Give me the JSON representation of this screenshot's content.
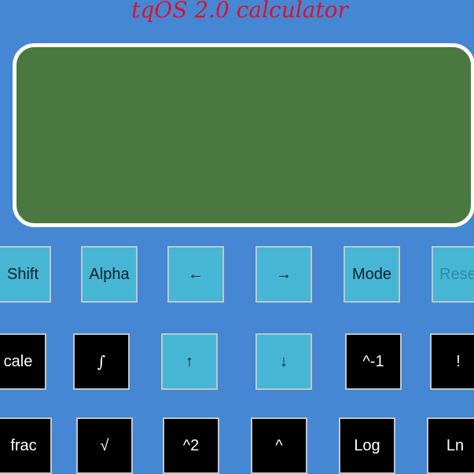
{
  "app": {
    "title": "tqOS 2.0 calculator"
  },
  "colors": {
    "background": "#4587d2",
    "screen": "#4b7840",
    "title": "#e0102a",
    "function_key": "#46b6d4",
    "operation_key": "#000000"
  },
  "keys": {
    "row1": [
      "Shift",
      "Alpha",
      "←",
      "→",
      "Mode",
      "Rese"
    ],
    "row2": [
      "cale",
      "∫",
      "↑",
      "↓",
      "^-1",
      "!"
    ],
    "row3": [
      "frac",
      "√",
      "^2",
      "^",
      "Log",
      "Ln"
    ]
  }
}
